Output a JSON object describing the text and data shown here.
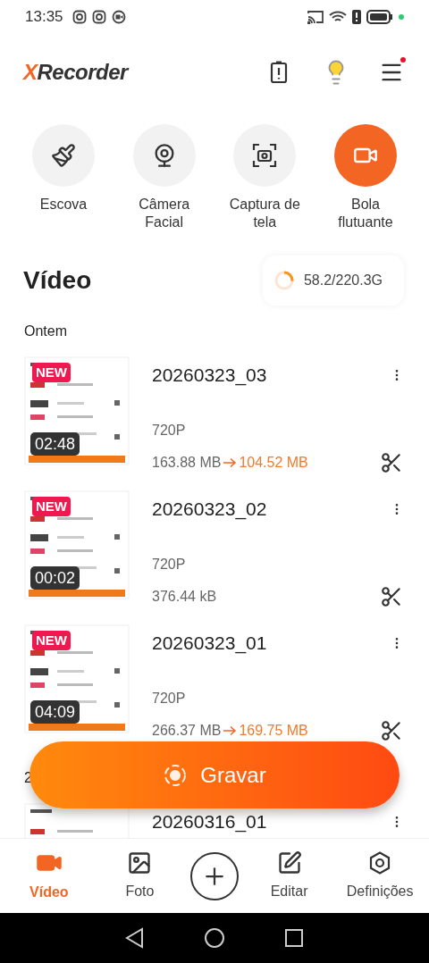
{
  "status_bar": {
    "time": "13:35"
  },
  "header": {
    "logo": {
      "mark": "X",
      "name": "Recorder"
    },
    "menu_badge": true
  },
  "quick_actions": [
    {
      "label": "Escova",
      "kind": "brush",
      "selected": false
    },
    {
      "label": "Câmera Facial",
      "kind": "webcam",
      "selected": false
    },
    {
      "label": "Captura de tela",
      "kind": "screenshot",
      "selected": false
    },
    {
      "label": "Bola flutuante",
      "kind": "float",
      "selected": true
    }
  ],
  "title": "Vídeo",
  "storage": {
    "reading": "58.2/220.3G"
  },
  "sections": [
    {
      "label": "Ontem",
      "videos": [
        {
          "name": "20260323_03",
          "badge": "NEW",
          "duration": "02:48",
          "resolution": "720P",
          "size": "163.88 MB",
          "compressed": "104.52 MB"
        },
        {
          "name": "20260323_02",
          "badge": "NEW",
          "duration": "00:02",
          "resolution": "720P",
          "size": "376.44 kB"
        },
        {
          "name": "20260323_01",
          "badge": "NEW",
          "duration": "04:09",
          "resolution": "720P",
          "size": "266.37 MB",
          "compressed": "169.75 MB"
        }
      ]
    },
    {
      "label": "2",
      "videos": [
        {
          "name": "20260316_01"
        }
      ]
    }
  ],
  "record_button": "Gravar",
  "bottom_nav": [
    {
      "label": "Vídeo",
      "kind": "video",
      "selected": true
    },
    {
      "label": "Foto",
      "selected": false
    },
    {
      "kind": "add",
      "selected": false
    },
    {
      "label": "Editar",
      "kind": "edit",
      "selected": false
    },
    {
      "label": "Definições",
      "kind": "settings",
      "selected": false
    }
  ]
}
